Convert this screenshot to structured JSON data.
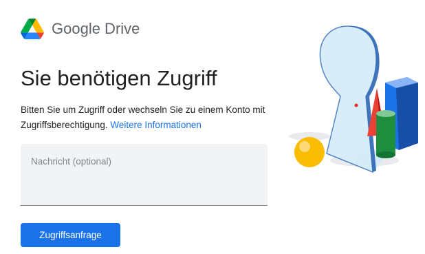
{
  "header": {
    "logo_icon": "google-drive-icon",
    "brand_name": "Google Drive"
  },
  "main": {
    "title": "Sie benötigen Zugriff",
    "description": "Bitten Sie um Zugriff oder wechseln Sie zu einem Konto mit Zugriffsberechtigung.",
    "learn_more_link": "Weitere Informationen",
    "message_placeholder": "Nachricht (optional)",
    "request_button_label": "Zugriffsanfrage"
  },
  "illustration": {
    "icon": "keyhole-shapes-illustration"
  },
  "colors": {
    "accent": "#1a73e8",
    "title_text": "#202124",
    "secondary_text": "#5f6368",
    "input_background": "#f1f3f4"
  }
}
